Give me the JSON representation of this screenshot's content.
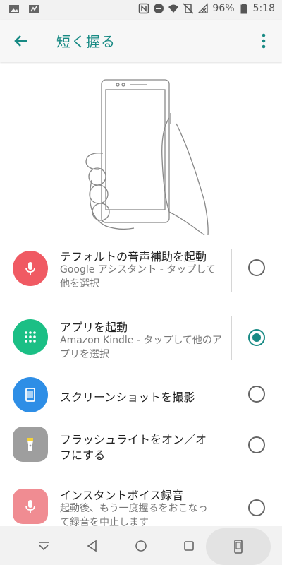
{
  "status_bar": {
    "battery_percent": "96%",
    "time": "5:18"
  },
  "app_bar": {
    "title": "短く握る"
  },
  "options": [
    {
      "title": "テフォルトの音声補助を起動",
      "subtitle_line1": "Google アシスタント - タップして",
      "subtitle_line2": "他を選択",
      "icon": "microphone-icon",
      "icon_color": "#f05a63",
      "selected": false
    },
    {
      "title": "アプリを起動",
      "subtitle_line1": "Amazon Kindle - タップして他のア",
      "subtitle_line2": "プリを選択",
      "icon": "app-grid-icon",
      "icon_color": "#1bbf85",
      "selected": true
    },
    {
      "title": "スクリーンショットを撮影",
      "icon": "screenshot-icon",
      "icon_color": "#2e8ee6",
      "selected": false
    },
    {
      "title_line1": "フラッシュライトをオン／オ",
      "title_line2": "フにする",
      "icon": "flashlight-icon",
      "icon_color": "#9e9e9e",
      "selected": false
    },
    {
      "title": "インスタントボイス録音",
      "subtitle_line1": "起動後、もう一度握るをおこなっ",
      "subtitle_line2": "て録音を中止します",
      "icon": "voice-recorder-icon",
      "icon_color": "#f08c92",
      "selected": false
    }
  ],
  "colors": {
    "accent": "#188a84",
    "divider": "#d6d6d6"
  }
}
